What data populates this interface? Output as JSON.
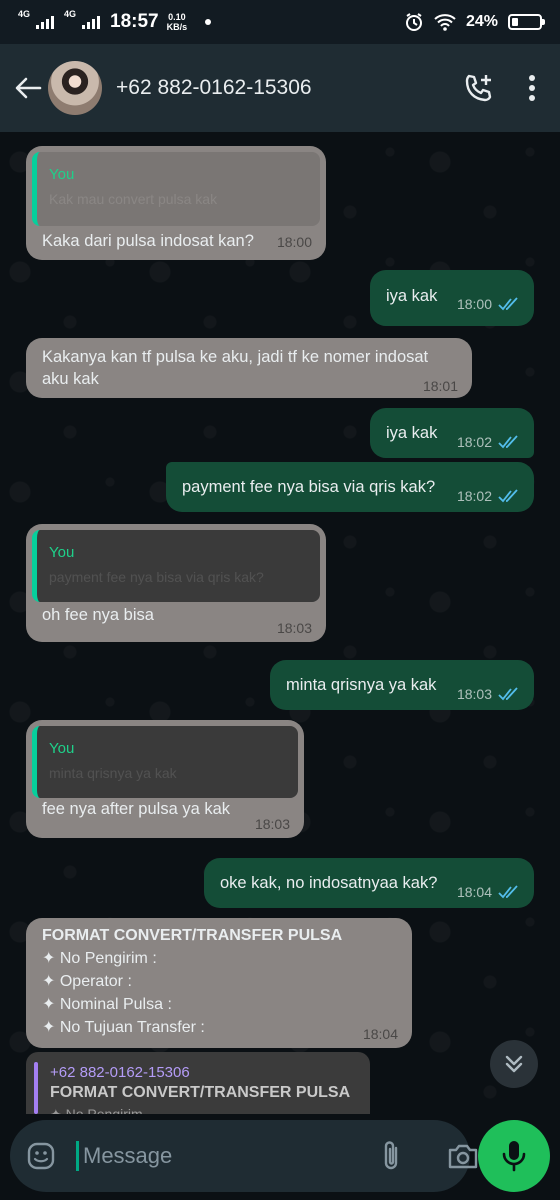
{
  "status_bar": {
    "net1": "4G",
    "net2": "4G",
    "time": "18:57",
    "speed_value": "0.10",
    "speed_unit": "KB/s",
    "battery_pct": "24%",
    "battery_level": 0.24
  },
  "header": {
    "contact": "+62 882-0162-15306"
  },
  "colors": {
    "incoming_bubble": "#8a8583",
    "outgoing_bubble": "#144d37",
    "accent": "#00a884",
    "header": "#1f2c33"
  },
  "messages": [
    {
      "quote_name": "You",
      "quote_text": "Kak mau convert pulsa kak",
      "text": "Kaka dari pulsa indosat kan?",
      "time": "18:00"
    },
    {
      "text": "iya kak",
      "time": "18:00"
    },
    {
      "text": "Kakanya kan tf pulsa ke aku, jadi tf ke nomer indosat aku kak",
      "time": "18:01"
    },
    {
      "text": "iya kak",
      "time": "18:02"
    },
    {
      "text": "payment fee nya bisa via qris kak?",
      "time": "18:02"
    },
    {
      "quote_name": "You",
      "quote_text": "payment fee nya bisa via qris kak?",
      "text": "oh fee nya bisa",
      "time": "18:03"
    },
    {
      "text": "minta qrisnya ya kak",
      "time": "18:03"
    },
    {
      "quote_name": "You",
      "quote_text": "minta qrisnya ya kak",
      "text": "fee nya after pulsa ya kak",
      "time": "18:03"
    },
    {
      "text": "oke kak, no indosatnyaa kak?",
      "time": "18:04"
    },
    {
      "lines": [
        "FORMAT CONVERT/TRANSFER PULSA",
        "✦ No Pengirim :",
        "✦ Operator :",
        "✦ Nominal Pulsa :",
        "✦ No Tujuan Transfer :"
      ],
      "time": "18:04"
    }
  ],
  "reply_preview": {
    "sender": "+62 882-0162-15306",
    "title": "FORMAT CONVERT/TRANSFER PULSA",
    "snippet": "✦ No Pengirim"
  },
  "composer": {
    "placeholder": "Message"
  }
}
